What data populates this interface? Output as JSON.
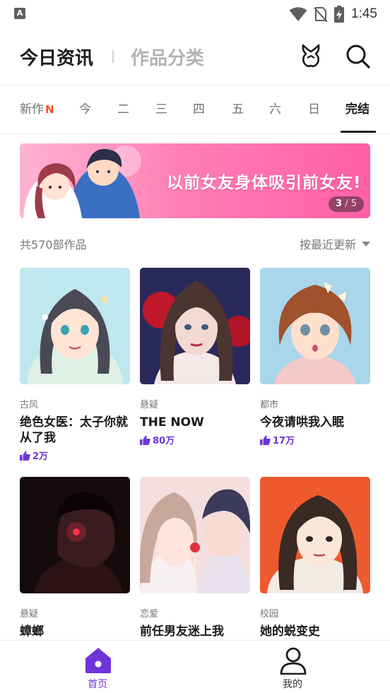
{
  "status_bar": {
    "time": "1:45",
    "app_icon_letter": "A"
  },
  "header": {
    "title": "今日资讯",
    "subtitle": "作品分类",
    "icons": [
      "gift-icon",
      "search-icon"
    ]
  },
  "day_tabs": [
    {
      "label": "新作",
      "badge": "N",
      "active": false
    },
    {
      "label": "今",
      "active": false
    },
    {
      "label": "二",
      "active": false
    },
    {
      "label": "三",
      "active": false
    },
    {
      "label": "四",
      "active": false
    },
    {
      "label": "五",
      "active": false
    },
    {
      "label": "六",
      "active": false
    },
    {
      "label": "日",
      "active": false
    },
    {
      "label": "完结",
      "active": true
    }
  ],
  "banner": {
    "text": "以前女友身体吸引前女友!",
    "pager_current": "3",
    "pager_rest": "/ 5"
  },
  "list": {
    "count_text": "共570部作品",
    "sort_label": "按最近更新"
  },
  "works": [
    {
      "genre": "古风",
      "title": "绝色女医：太子你就从了我",
      "likes": "2万"
    },
    {
      "genre": "悬疑",
      "title": "THE NOW",
      "likes": "80万"
    },
    {
      "genre": "都市",
      "title": "今夜请哄我入眠",
      "likes": "17万"
    },
    {
      "genre": "悬疑",
      "title": "蟑螂",
      "likes": ""
    },
    {
      "genre": "恋爱",
      "title": "前任男友迷上我",
      "likes": ""
    },
    {
      "genre": "校园",
      "title": "她的蜕变史",
      "likes": ""
    }
  ],
  "bottom_nav": [
    {
      "label": "首页",
      "icon": "home-icon",
      "active": true
    },
    {
      "label": "我的",
      "icon": "person-icon",
      "active": false
    }
  ],
  "colors": {
    "accent": "#6f34d7",
    "new_badge": "#ff4d23",
    "banner_pink": "#ff6fae"
  }
}
